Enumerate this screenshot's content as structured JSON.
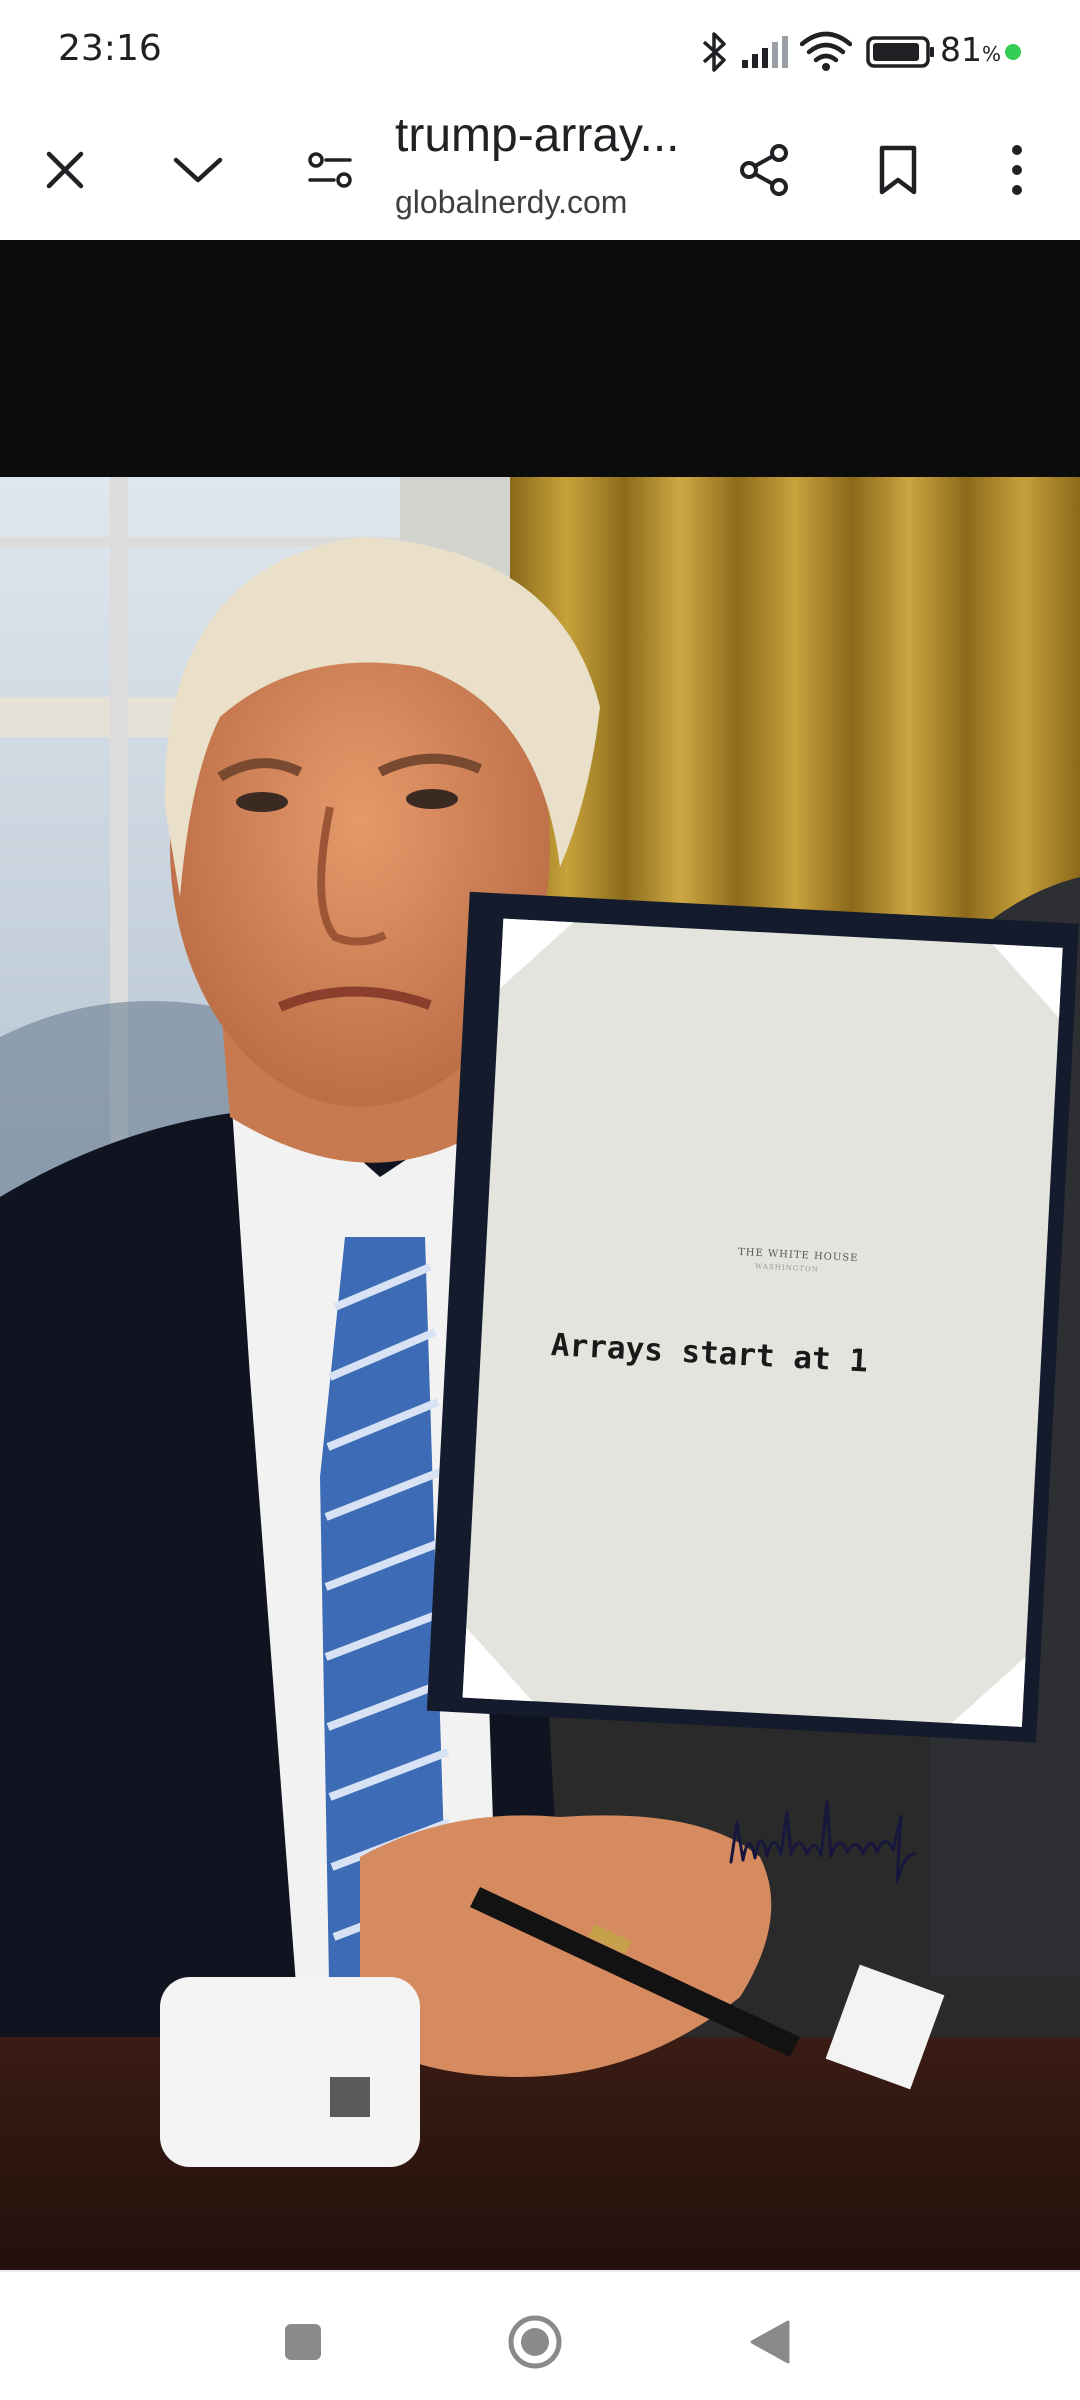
{
  "status": {
    "time": "23:16",
    "battery_percent": "81",
    "battery_unit": "%",
    "icons": [
      "bluetooth-icon",
      "signal-icon",
      "wifi-icon",
      "battery-icon"
    ]
  },
  "toolbar": {
    "title": "trump-array...",
    "domain": "globalnerdy.com",
    "buttons": [
      "close-icon",
      "chevron-down-icon",
      "page-info-icon",
      "share-icon",
      "bookmark-icon",
      "more-vert-icon"
    ]
  },
  "image": {
    "document_heading": "THE WHITE HOUSE",
    "document_subheading": "WASHINGTON",
    "document_text": "Arrays start at 1"
  },
  "navbar": {
    "buttons": [
      "recents-icon",
      "home-icon",
      "back-icon"
    ]
  },
  "colors": {
    "background": "#0c0c0c",
    "bar": "#ffffff",
    "text": "#202124",
    "battery_dot": "#33cc55"
  }
}
